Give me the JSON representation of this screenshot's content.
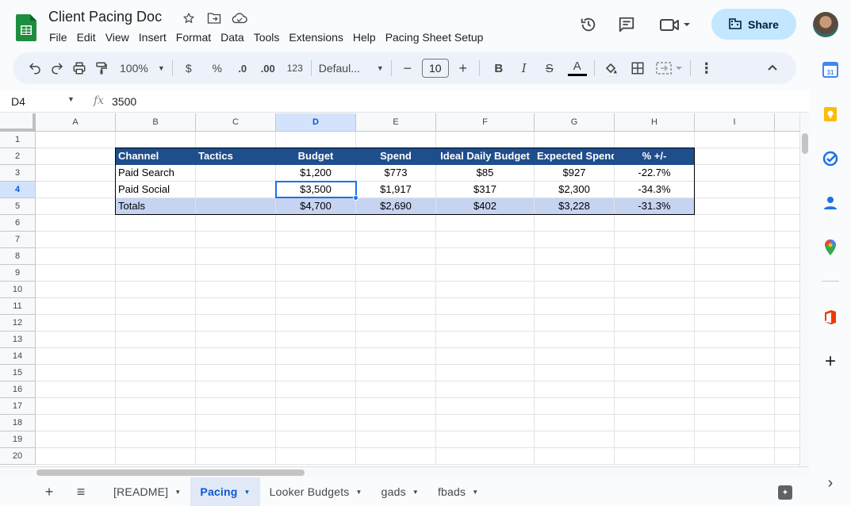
{
  "app": {
    "doc_title": "Client Pacing Doc",
    "title_icons": [
      "star-icon",
      "move-to-folder-icon",
      "cloud-status-icon"
    ],
    "menu": [
      "File",
      "Edit",
      "View",
      "Insert",
      "Format",
      "Data",
      "Tools",
      "Extensions",
      "Help",
      "Pacing Sheet Setup"
    ],
    "share_label": "Share",
    "brand_color": "#1e8e3e",
    "accent_color": "#0b57d0"
  },
  "toolbar": {
    "zoom": "100%",
    "currency": "$",
    "percent": "%",
    "dec_decrease": ".0",
    "dec_increase": ".00",
    "number_format": "123",
    "font": "Defaul...",
    "font_size": "10",
    "minus": "−",
    "plus": "+",
    "bold": "B",
    "italic": "I",
    "strike": "S",
    "text_color": "A",
    "more": "⋮",
    "collapse": "⌃"
  },
  "formula_bar": {
    "name_box": "D4",
    "fx": "fx",
    "value": "3500"
  },
  "grid": {
    "columns": [
      "A",
      "B",
      "C",
      "D",
      "E",
      "F",
      "G",
      "H",
      "I"
    ],
    "rows": [
      "1",
      "2",
      "3",
      "4",
      "5",
      "6",
      "7",
      "8",
      "9",
      "10",
      "11",
      "12",
      "13",
      "14",
      "15",
      "16",
      "17",
      "18",
      "19",
      "20"
    ],
    "selected_cell": "D4",
    "table": {
      "headers": [
        "Channel",
        "Tactics",
        "Budget",
        "Spend",
        "Ideal Daily Budget",
        "Expected Spend",
        "% +/-"
      ],
      "rows": [
        [
          "Paid Search",
          "",
          "$1,200",
          "$773",
          "$85",
          "$927",
          "-22.7%"
        ],
        [
          "Paid Social",
          "",
          "$3,500",
          "$1,917",
          "$317",
          "$2,300",
          "-34.3%"
        ]
      ],
      "totals": [
        "Totals",
        "",
        "$4,700",
        "$2,690",
        "$402",
        "$3,228",
        "-31.3%"
      ],
      "header_color": "#1f4e8d",
      "totals_color": "#c6d4f1"
    }
  },
  "sheet_tabs": {
    "add": "+",
    "all_sheets": "≡",
    "tabs": [
      {
        "label": "[README]",
        "active": false
      },
      {
        "label": "Pacing",
        "active": true
      },
      {
        "label": "Looker Budgets",
        "active": false
      },
      {
        "label": "gads",
        "active": false
      },
      {
        "label": "fbads",
        "active": false
      }
    ]
  },
  "side_panel": {
    "icons": [
      "calendar-icon",
      "keep-icon",
      "tasks-icon",
      "contacts-icon",
      "maps-icon",
      "office-addon-icon",
      "add-icon"
    ],
    "calendar_day": "31",
    "add": "+",
    "expand": "›"
  }
}
